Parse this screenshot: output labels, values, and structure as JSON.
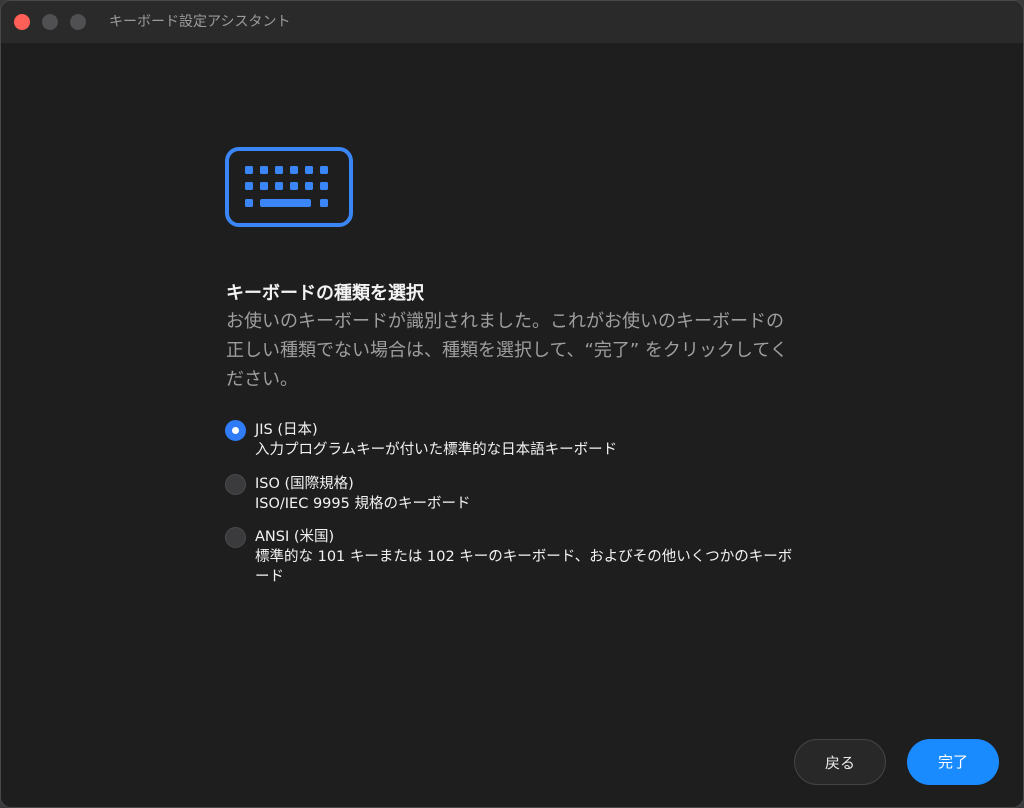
{
  "window": {
    "title": "キーボード設定アシスタント"
  },
  "icon": {
    "name": "keyboard-icon",
    "color": "#3a86f6"
  },
  "main": {
    "heading": "キーボードの種類を選択",
    "description": "お使いのキーボードが識別されました。これがお使いのキーボードの正しい種類でない場合は、種類を選択して、“完了” をクリックしてください。"
  },
  "options": [
    {
      "title": "JIS (日本)",
      "description": "入力プログラムキーが付いた標準的な日本語キーボード",
      "selected": true
    },
    {
      "title": "ISO (国際規格)",
      "description": "ISO/IEC 9995 規格のキーボード",
      "selected": false
    },
    {
      "title": "ANSI (米国)",
      "description": "標準的な 101 キーまたは 102 キーのキーボード、およびその他いくつかのキーボード",
      "selected": false
    }
  ],
  "buttons": {
    "back": "戻る",
    "done": "完了"
  },
  "colors": {
    "accent": "#1a8bff",
    "radio_selected": "#2f7cf6",
    "window_background": "#1e1e1e",
    "close_button": "#ff5f57"
  }
}
